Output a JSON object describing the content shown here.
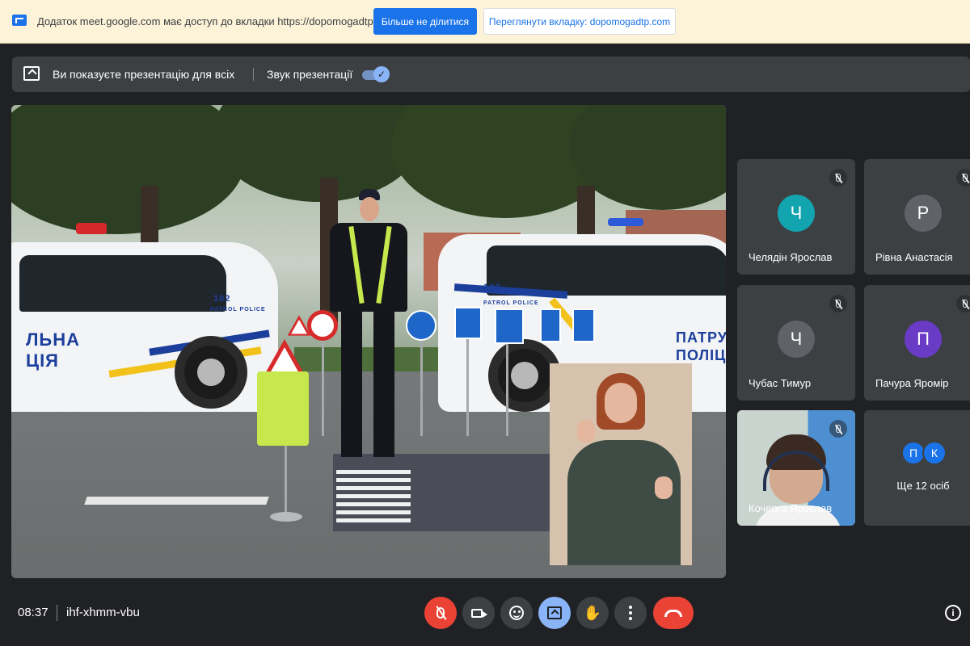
{
  "share_bar": {
    "message": "Додаток meet.google.com має доступ до вкладки https://dopomogadtp.com",
    "stop_sharing_label": "Більше не ділитися",
    "view_tab_label": "Переглянути вкладку: dopomogadtp.com"
  },
  "presenting_bar": {
    "presenting_text": "Ви показуєте презентацію для всіх",
    "audio_label": "Звук презентації",
    "audio_enabled": true
  },
  "presentation": {
    "car_left_number": "102",
    "car_left_brand": "PATROL POLICE",
    "car_left_text_1": "ЛЬНА",
    "car_left_text_2": "ЦІЯ",
    "car_right_number": "102",
    "car_right_brand": "PATROL POLICE",
    "car_right_text_1": "ПАТРУЛЬ",
    "car_right_text_2": "ПОЛІЦІ"
  },
  "participants": [
    {
      "initial": "Ч",
      "name": "Челядін Ярослав",
      "color": "#12a4af",
      "muted": true
    },
    {
      "initial": "Р",
      "name": "Рівна Анастасія",
      "color": "#5f6368",
      "muted": true
    },
    {
      "initial": "Ч",
      "name": "Чубас Тимур",
      "color": "#5f6368",
      "muted": true
    },
    {
      "initial": "П",
      "name": "Пачура Яромір",
      "color": "#6a3bc4",
      "muted": true
    },
    {
      "initial": "",
      "name": "Кочерга Ярослав",
      "color": "",
      "muted": true,
      "camera_on": true
    }
  ],
  "more_participants": {
    "avatars": [
      {
        "initial": "П",
        "color": "#1a73e8"
      },
      {
        "initial": "К",
        "color": "#1a73e8"
      }
    ],
    "label": "Ще 12 осіб"
  },
  "bottom_bar": {
    "time": "08:37",
    "meeting_code": "ihf-xhmm-vbu",
    "controls": [
      "mic-off",
      "camera",
      "reactions",
      "present",
      "raise-hand",
      "more-options",
      "leave-call"
    ]
  },
  "info_icon": "info-icon",
  "colors": {
    "accent": "#1a73e8",
    "meet_bg": "#202124",
    "tile_bg": "#3c4043",
    "danger": "#ea4335",
    "active": "#8ab4f8"
  }
}
